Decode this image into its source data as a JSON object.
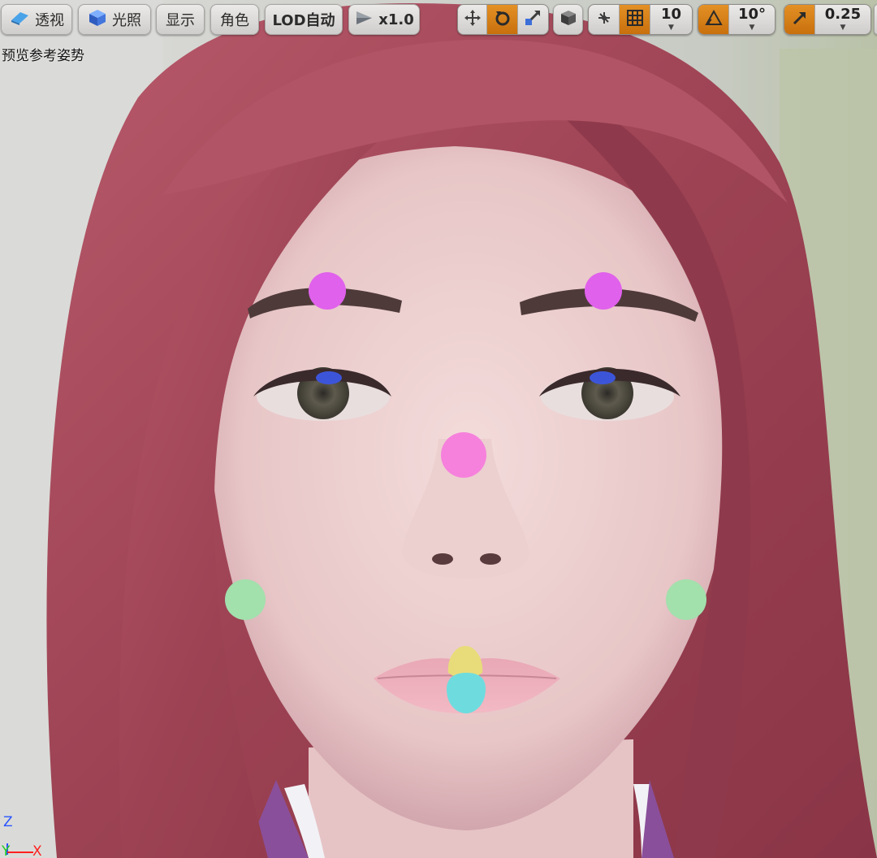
{
  "toolbar": {
    "perspective_label": "透视",
    "lighting_label": "光照",
    "show_label": "显示",
    "character_label": "角色",
    "lod_label": "LOD自动",
    "play_speed_label": "x1.0",
    "grid_snap_value": "10",
    "rotation_snap_value": "10°",
    "scale_snap_value": "0.25"
  },
  "viewport": {
    "caption": "预览参考姿势",
    "axis": {
      "z": "Z",
      "y": "Y",
      "x": "X"
    },
    "markers": [
      {
        "name": "left-brow-marker",
        "color": "#e061ec"
      },
      {
        "name": "right-brow-marker",
        "color": "#e061ec"
      },
      {
        "name": "nose-bridge-marker",
        "color": "#f681dc"
      },
      {
        "name": "left-cheek-marker",
        "color": "#a2e0ac"
      },
      {
        "name": "right-cheek-marker",
        "color": "#a2e0ac"
      },
      {
        "name": "upper-lip-marker",
        "color": "#e8dc7a"
      },
      {
        "name": "lower-lip-marker",
        "color": "#6edcde"
      }
    ]
  },
  "colors": {
    "accent": "#d98316",
    "hair": "#a5495a",
    "skin": "#efd7d6"
  }
}
